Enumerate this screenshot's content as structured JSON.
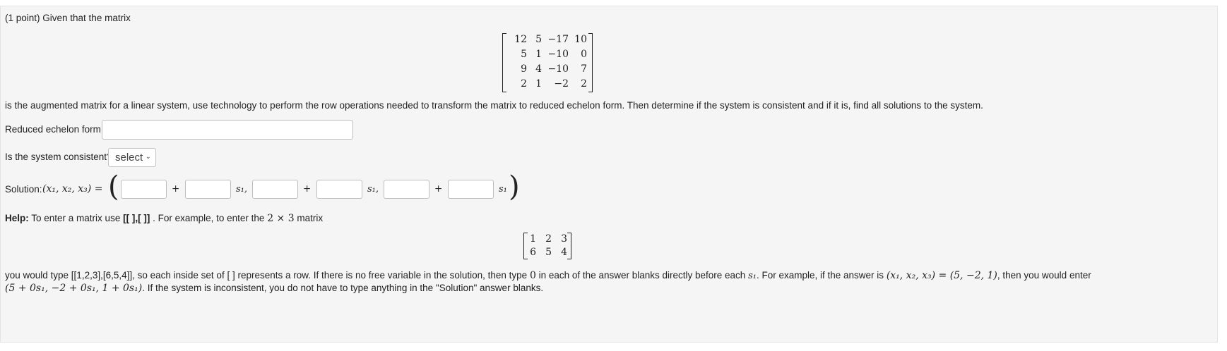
{
  "problem": {
    "intro": "(1 point) Given that the matrix",
    "matrix": [
      [
        "12",
        "5",
        "−17",
        "10"
      ],
      [
        "5",
        "1",
        "−10",
        "0"
      ],
      [
        "9",
        "4",
        "−10",
        "7"
      ],
      [
        "2",
        "1",
        "−2",
        "2"
      ]
    ],
    "instruction": "is the augmented matrix for a linear system, use technology to perform the row operations needed to transform the matrix to reduced echelon form. Then determine if the system is consistent and if it is, find all solutions to the system.",
    "reduced_label": "Reduced echelon form:",
    "reduced_value": "",
    "consistent_label": "Is the system consistent?",
    "consistent_select": "select",
    "solution_label": "Solution:",
    "solution_tuple": "(x₁, x₂, x₃) =",
    "plus": "+",
    "s1": "s₁",
    "s1_comma": "s₁,",
    "help": {
      "bold": "Help:",
      "text_a": "To enter a matrix use",
      "syntax": "[[ ],[ ]]",
      "text_b": ". For example, to enter the",
      "dims": "2 × 3",
      "text_c": "matrix",
      "example_matrix": [
        [
          "1",
          "2",
          "3"
        ],
        [
          "6",
          "5",
          "4"
        ]
      ],
      "line1_a": "you would type [[1,2,3],[6,5,4]], so each inside set of [ ] represents a row. If there is no free variable in the solution, then type",
      "zero": "0",
      "line1_b": "in each of the answer blanks directly before each",
      "s1": "s₁",
      "line1_c": ". For example, if the answer is",
      "tuple": "(x₁, x₂, x₃) = (5, −2, 1)",
      "line1_d": ", then you would enter",
      "entered": "(5 + 0s₁, −2 + 0s₁, 1 + 0s₁)",
      "line2_b": ". If the system is inconsistent, you do not have to type anything in the \"Solution\" answer blanks."
    }
  }
}
